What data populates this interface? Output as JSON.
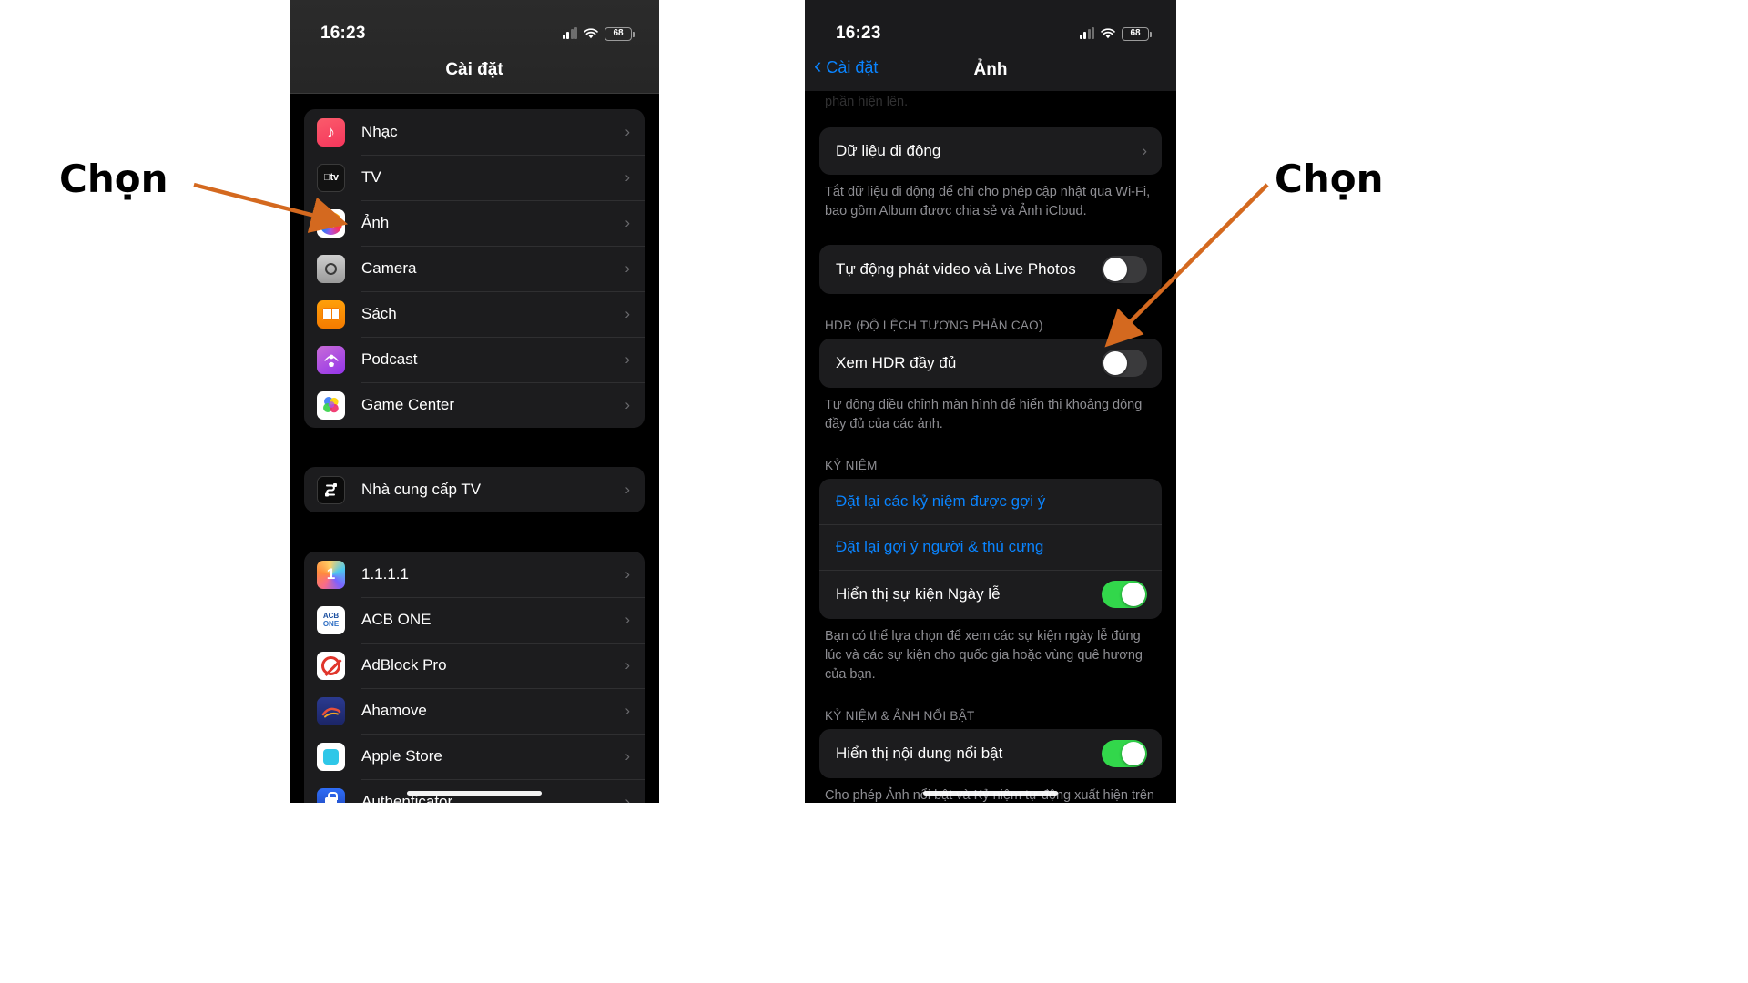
{
  "annotations": {
    "left_label": "Chọn",
    "right_label": "Chọn",
    "arrow_color": "#d4691f"
  },
  "left_phone": {
    "status": {
      "time": "16:23",
      "battery": "68"
    },
    "nav": {
      "title": "Cài đặt"
    },
    "groups": [
      {
        "rows": [
          {
            "label": "Nhạc",
            "icon": "music-icon",
            "chevron": "›"
          },
          {
            "label": "TV",
            "icon": "appletv-icon",
            "chevron": "›"
          },
          {
            "label": "Ảnh",
            "icon": "photos-icon",
            "chevron": "›"
          },
          {
            "label": "Camera",
            "icon": "camera-icon",
            "chevron": "›"
          },
          {
            "label": "Sách",
            "icon": "books-icon",
            "chevron": "›"
          },
          {
            "label": "Podcast",
            "icon": "podcast-icon",
            "chevron": "›"
          },
          {
            "label": "Game Center",
            "icon": "gamecenter-icon",
            "chevron": "›"
          }
        ]
      },
      {
        "rows": [
          {
            "label": "Nhà cung cấp TV",
            "icon": "tv-provider-icon",
            "chevron": "›"
          }
        ]
      },
      {
        "rows": [
          {
            "label": "1.1.1.1",
            "icon": "one-one-icon",
            "chevron": "›"
          },
          {
            "label": "ACB ONE",
            "icon": "acb-one-icon",
            "chevron": "›"
          },
          {
            "label": "AdBlock Pro",
            "icon": "adblock-pro-icon",
            "chevron": "›"
          },
          {
            "label": "Ahamove",
            "icon": "ahamove-icon",
            "chevron": "›"
          },
          {
            "label": "Apple Store",
            "icon": "apple-store-icon",
            "chevron": "›"
          },
          {
            "label": "Authenticator",
            "icon": "authenticator-icon",
            "chevron": "›"
          }
        ]
      }
    ],
    "icon_labels": {
      "appletv": "tv",
      "acb_line1": "ACB",
      "acb_line2": "ONE",
      "one_number": "1",
      "provider_glyph": "S"
    }
  },
  "right_phone": {
    "status": {
      "time": "16:23",
      "battery": "68"
    },
    "nav": {
      "back_label": "Cài đặt",
      "back_chevron": "‹",
      "title": "Ảnh"
    },
    "clipped_text": "phần hiện lên.",
    "sections": [
      {
        "type": "group",
        "rows": [
          {
            "label": "Dữ liệu di động",
            "control": "chevron",
            "chevron": "›"
          }
        ],
        "footnote": "Tắt dữ liệu di động để chỉ cho phép cập nhật qua Wi-Fi, bao gồm Album được chia sẻ và Ảnh iCloud."
      },
      {
        "type": "group",
        "rows": [
          {
            "label": "Tự động phát video và Live Photos",
            "control": "toggle",
            "state": "off"
          }
        ]
      },
      {
        "type": "header",
        "header": "HDR (ĐỘ LỆCH TƯƠNG PHẢN CAO)"
      },
      {
        "type": "group",
        "rows": [
          {
            "label": "Xem HDR đầy đủ",
            "control": "toggle",
            "state": "off"
          }
        ],
        "footnote": "Tự động điều chỉnh màn hình để hiển thị khoảng động đầy đủ của các ảnh."
      },
      {
        "type": "header",
        "header": "KỶ NIỆM"
      },
      {
        "type": "group",
        "rows": [
          {
            "label": "Đặt lại các kỷ niệm được gợi ý",
            "control": "none",
            "style": "blue"
          },
          {
            "label": "Đặt lại gợi ý người & thú cưng",
            "control": "none",
            "style": "blue"
          },
          {
            "label": "Hiển thị sự kiện Ngày lễ",
            "control": "toggle",
            "state": "on"
          }
        ],
        "footnote": "Bạn có thể lựa chọn để xem các sự kiện ngày lễ đúng lúc và các sự kiện cho quốc gia hoặc vùng quê hương của bạn."
      },
      {
        "type": "header",
        "header": "KỶ NIỆM & ẢNH NỔI BẬT"
      },
      {
        "type": "group",
        "rows": [
          {
            "label": "Hiển thị nội dung nổi bật",
            "control": "toggle",
            "state": "on"
          }
        ],
        "footnote": "Cho phép Ảnh nổi bật và Kỷ niệm tự động xuất hiện trên thiết bị này tại các địa điểm như Cho bạn và Tìm"
      }
    ]
  },
  "colors": {
    "accent_blue": "#0a84ff",
    "toggle_on": "#32d74b",
    "toggle_off": "#3a3a3c",
    "card_bg": "#1c1c1e",
    "page_bg": "#000000",
    "secondary_text": "#8e8e93"
  }
}
